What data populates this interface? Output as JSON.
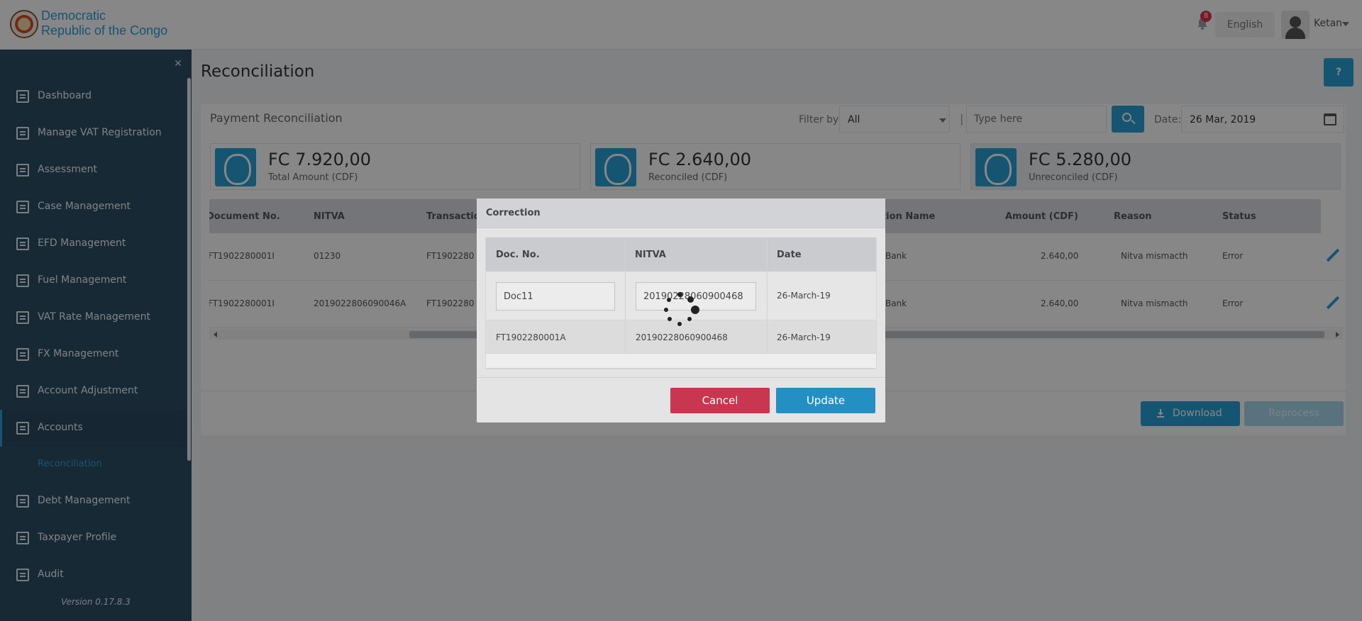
{
  "header": {
    "brand_line1": "Democratic",
    "brand_line2": "Republic of the Congo",
    "notification_count": "8",
    "language": "English",
    "username": "Ketan"
  },
  "sidebar": {
    "items": [
      {
        "label": "Dashboard",
        "icon": "dashboard-icon"
      },
      {
        "label": "Manage VAT Registration",
        "icon": "registration-icon"
      },
      {
        "label": "Assessment",
        "icon": "assessment-icon"
      },
      {
        "label": "Case Management",
        "icon": "folder-icon"
      },
      {
        "label": "EFD Management",
        "icon": "device-icon"
      },
      {
        "label": "Fuel Management",
        "icon": "fuel-icon"
      },
      {
        "label": "VAT Rate Management",
        "icon": "rate-icon"
      },
      {
        "label": "FX Management",
        "icon": "fx-icon"
      },
      {
        "label": "Account Adjustment",
        "icon": "adjustment-icon"
      },
      {
        "label": "Accounts",
        "icon": "accounts-icon"
      },
      {
        "label": "Debt Management",
        "icon": "debt-icon"
      },
      {
        "label": "Taxpayer Profile",
        "icon": "profile-icon"
      },
      {
        "label": "Audit",
        "icon": "audit-icon"
      }
    ],
    "sub_item": "Reconciliation",
    "version": "Version 0.17.8.3"
  },
  "page": {
    "title": "Reconciliation",
    "help": "?",
    "card_title": "Payment Reconciliation",
    "filter_label": "Filter by",
    "filter_value": "All",
    "separator": "|",
    "search_placeholder": "Type here",
    "date_label": "Date:",
    "date_value": "26 Mar, 2019"
  },
  "stats": [
    {
      "amount": "FC 7.920,00",
      "label": "Total Amount (CDF)"
    },
    {
      "amount": "FC 2.640,00",
      "label": "Reconciled (CDF)"
    },
    {
      "amount": "FC 5.280,00",
      "label": "Unreconciled (CDF)"
    }
  ],
  "table": {
    "headers": [
      "Document No.",
      "NITVA",
      "Transaction",
      "Institution Name",
      "Amount (CDF)",
      "Reason",
      "Status"
    ],
    "rows": [
      {
        "doc": "FT1902280001I",
        "nitva": "01230",
        "txn": "FT1902280",
        "inst": "Trust Merchant Bank",
        "amount": "2.640,00",
        "reason": "Nitva mismacth",
        "status": "Error"
      },
      {
        "doc": "FT1902280001I",
        "nitva": "2019022806090046A",
        "txn": "FT1902280",
        "inst": "Trust Merchant Bank",
        "amount": "2.640,00",
        "reason": "Nitva mismacth",
        "status": "Error"
      }
    ]
  },
  "actions": {
    "download": "Download",
    "reprocess": "Reprocess"
  },
  "modal": {
    "title": "Correction",
    "headers": [
      "Doc. No.",
      "NITVA",
      "Date"
    ],
    "edit_row": {
      "doc": "Doc11",
      "nitva": "20190228060900468",
      "date": "26-March-19"
    },
    "row": {
      "doc": "FT1902280001A",
      "nitva": "20190228060900468",
      "date": "26-March-19"
    },
    "cancel": "Cancel",
    "update": "Update"
  },
  "colors": {
    "accent": "#2ba0d8",
    "sidebar": "#2f4f67",
    "danger": "#c9364f"
  }
}
